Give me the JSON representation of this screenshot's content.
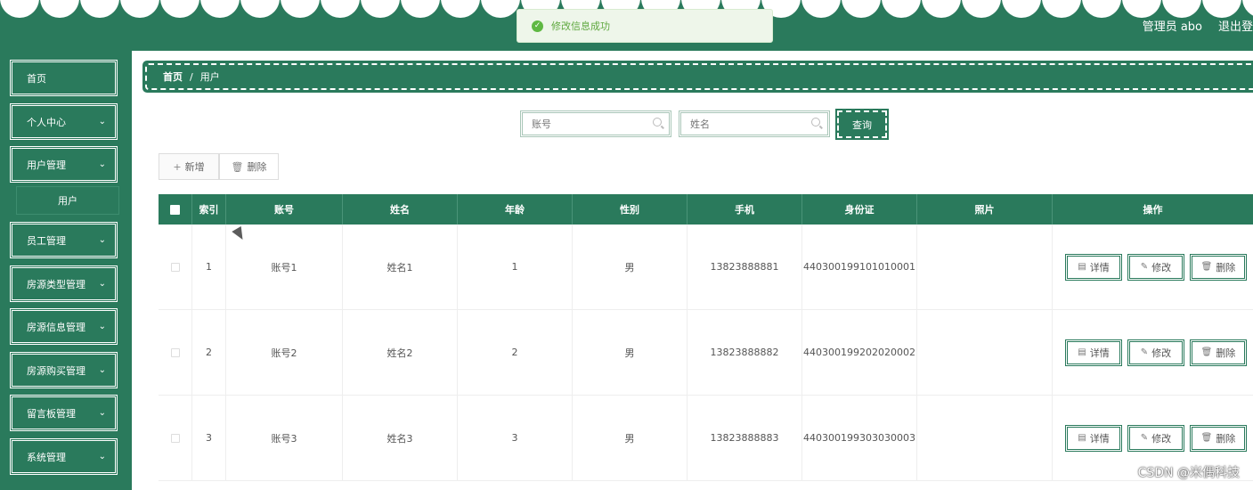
{
  "header": {
    "user_label": "管理员 abo",
    "logout_label": "退出登录",
    "bg_color": "#2a7a5c"
  },
  "toast": {
    "icon": "check-icon",
    "text": "修改信息成功"
  },
  "sidebar": {
    "items": [
      {
        "label": "首页",
        "has_arrow": false
      },
      {
        "label": "个人中心",
        "has_arrow": true
      },
      {
        "label": "用户管理",
        "has_arrow": true
      },
      {
        "label": "员工管理",
        "has_arrow": true
      },
      {
        "label": "房源类型管理",
        "has_arrow": true
      },
      {
        "label": "房源信息管理",
        "has_arrow": true
      },
      {
        "label": "房源购买管理",
        "has_arrow": true
      },
      {
        "label": "留言板管理",
        "has_arrow": true
      },
      {
        "label": "系统管理",
        "has_arrow": true
      }
    ],
    "sub_item": "用户"
  },
  "breadcrumb": {
    "home": "首页",
    "separator": "/",
    "current": "用户"
  },
  "search": {
    "account_placeholder": "账号",
    "name_placeholder": "姓名",
    "query_label": "查询"
  },
  "toolbar": {
    "add_label": "新增",
    "delete_label": "删除"
  },
  "table": {
    "headers": [
      "索引",
      "账号",
      "姓名",
      "年龄",
      "性别",
      "手机",
      "身份证",
      "照片",
      "操作"
    ],
    "rows": [
      {
        "index": "1",
        "account": "账号1",
        "name": "姓名1",
        "age": "1",
        "gender": "男",
        "phone": "13823888881",
        "id_card": "440300199101010001"
      },
      {
        "index": "2",
        "account": "账号2",
        "name": "姓名2",
        "age": "2",
        "gender": "男",
        "phone": "13823888882",
        "id_card": "440300199202020002"
      },
      {
        "index": "3",
        "account": "账号3",
        "name": "姓名3",
        "age": "3",
        "gender": "男",
        "phone": "13823888883",
        "id_card": "440300199303030003"
      }
    ],
    "ops": {
      "detail": "详情",
      "edit": "修改",
      "delete": "删除"
    }
  },
  "watermark": "CSDN @米偶科技"
}
